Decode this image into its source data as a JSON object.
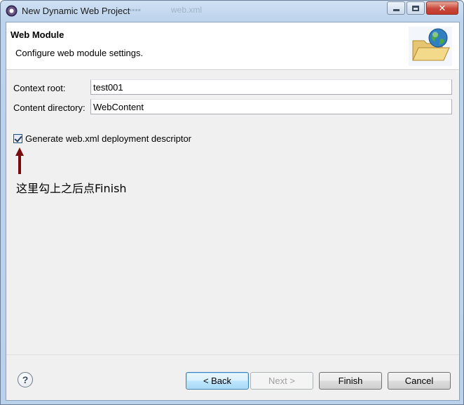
{
  "window": {
    "title": "New Dynamic Web Project",
    "ghost_tabs": [
      "web.xml"
    ]
  },
  "header": {
    "title": "Web Module",
    "description": "Configure web module settings."
  },
  "form": {
    "context_root_label": "Context root:",
    "context_root_value": "test001",
    "content_dir_label": "Content directory:",
    "content_dir_value": "WebContent",
    "generate_label": "Generate web.xml deployment descriptor",
    "generate_checked": true
  },
  "annotation": {
    "text": "这里勾上之后点Finish",
    "color": "#7a0c0c"
  },
  "buttons": {
    "back": "< Back",
    "next": "Next >",
    "finish": "Finish",
    "cancel": "Cancel",
    "help": "?"
  },
  "icons": {
    "app": "eclipse-icon",
    "header_art": "folder-globe-icon",
    "help": "help-icon",
    "minimize": "minimize-icon",
    "maximize": "maximize-icon",
    "close": "close-icon"
  }
}
